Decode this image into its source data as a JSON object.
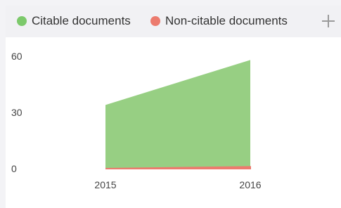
{
  "chart_data": {
    "type": "area",
    "x": [
      "2015",
      "2016"
    ],
    "series": [
      {
        "name": "Citable documents",
        "values": [
          34,
          58
        ],
        "color": "#97cf83"
      },
      {
        "name": "Non-citable documents",
        "values": [
          0,
          1
        ],
        "color": "#ec7b6e"
      }
    ],
    "yticks": [
      "0",
      "30",
      "60"
    ],
    "ylim": [
      0,
      60
    ]
  },
  "legend": {
    "items": [
      {
        "label": "Citable documents",
        "color": "#7cc96b"
      },
      {
        "label": "Non-citable documents",
        "color": "#ec7b6e"
      }
    ],
    "add_icon": "plus-icon"
  }
}
